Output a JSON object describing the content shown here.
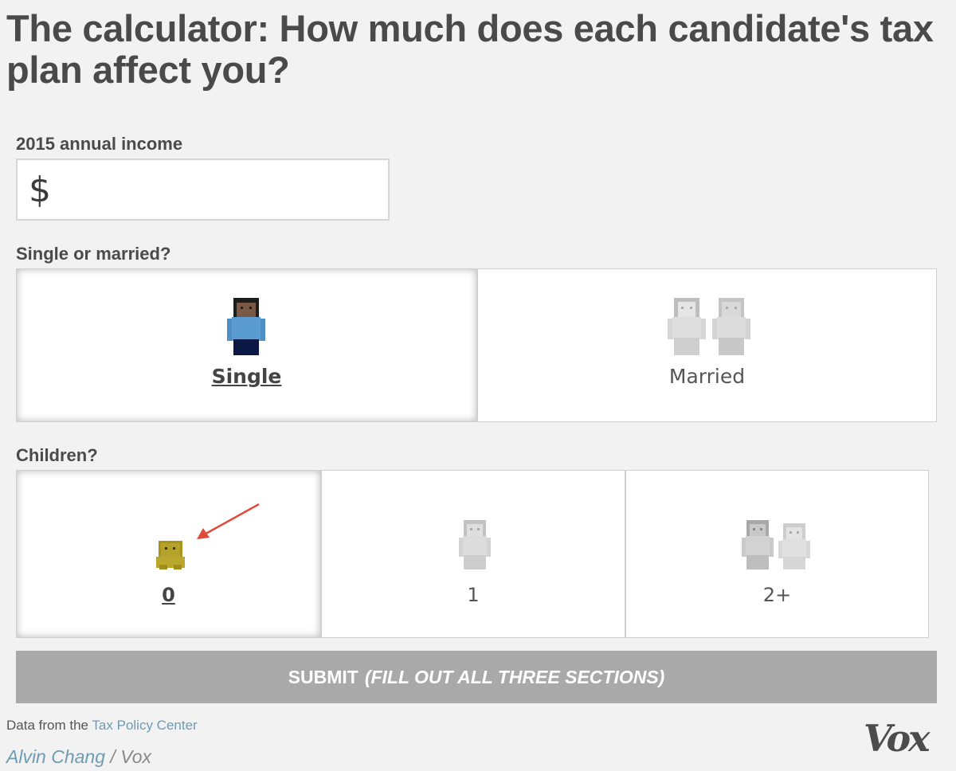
{
  "title": "The calculator: How much does each candidate's tax plan affect you?",
  "income": {
    "label": "2015 annual income",
    "currency_symbol": "$",
    "value": ""
  },
  "marital": {
    "label": "Single or married?",
    "options": [
      {
        "label": "Single",
        "selected": true,
        "icon": "single-person-icon"
      },
      {
        "label": "Married",
        "selected": false,
        "icon": "married-couple-icon"
      }
    ]
  },
  "children": {
    "label": "Children?",
    "options": [
      {
        "label": "0",
        "selected": true,
        "icon": "no-child-icon"
      },
      {
        "label": "1",
        "selected": false,
        "icon": "one-child-icon"
      },
      {
        "label": "2+",
        "selected": false,
        "icon": "two-children-icon"
      }
    ]
  },
  "submit": {
    "label": "SUBMIT",
    "hint": "(FILL OUT ALL THREE SECTIONS)"
  },
  "footer": {
    "source_prefix": "Data from the",
    "source_link": "Tax Policy Center",
    "author": "Alvin Chang",
    "separator": "/",
    "publication": "Vox",
    "logo": "Vox"
  },
  "colors": {
    "background": "#f1f2f1",
    "accent_link": "#6f9bb3",
    "submit_bg": "#a9a9a9",
    "single_shirt": "#4f8fc7",
    "child_selected": "#b5a22a",
    "annotation_arrow": "#e04a3a"
  }
}
